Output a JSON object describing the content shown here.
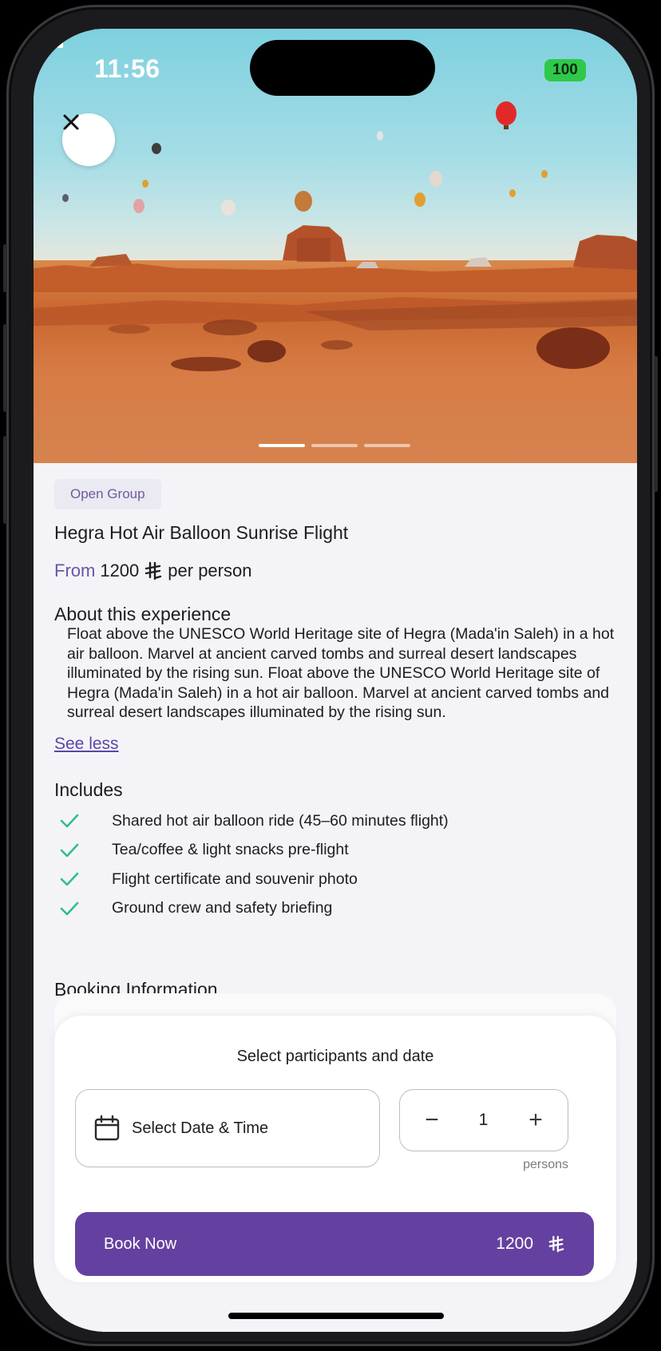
{
  "status_bar": {
    "time": "11:56",
    "battery": "100"
  },
  "hero": {
    "slides_total": 3,
    "active_slide": 1
  },
  "experience": {
    "badge": "Open Group",
    "title": "Hegra Hot Air Balloon Sunrise Flight",
    "price_from": "From",
    "price_value": "1200",
    "currency_icon": "riyal-icon",
    "price_unit": "per person",
    "about_heading": "About this experience",
    "about_text": "Float above the UNESCO World Heritage site of Hegra (Mada'in Saleh) in a hot air balloon. Marvel at ancient carved tombs and surreal desert landscapes illuminated by the rising sun. Float above the UNESCO World Heritage site of Hegra (Mada'in Saleh) in a hot air balloon. Marvel at ancient carved tombs and surreal desert landscapes illuminated by the rising sun.",
    "see_less": "See less",
    "includes_heading": "Includes",
    "includes": [
      "Shared hot air balloon ride (45–60 minutes flight)",
      "Tea/coffee & light snacks pre-flight",
      "Flight certificate and souvenir photo",
      "Ground crew and safety briefing"
    ],
    "booking_heading": "Booking Information"
  },
  "booking_card": {
    "title": "Select participants and date",
    "date_placeholder": "Select Date & Time",
    "participants": "1",
    "participants_unit": "persons",
    "minus": "−",
    "plus": "+",
    "book_label": "Book Now",
    "book_price": "1200"
  },
  "colors": {
    "accent": "#6441a0",
    "check": "#2fbf8a",
    "link": "#5b45a8"
  }
}
